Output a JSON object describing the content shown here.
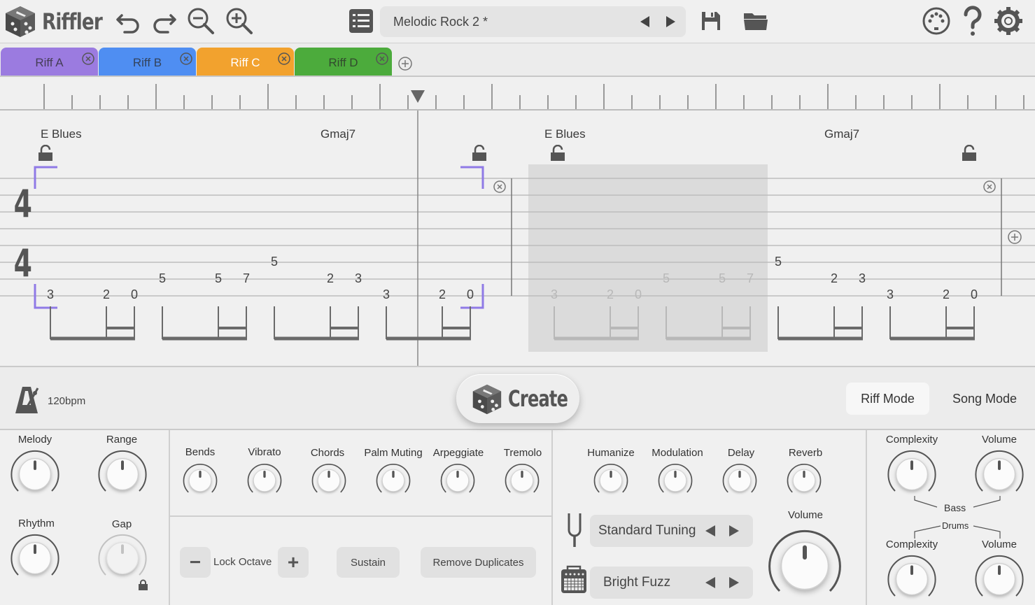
{
  "app": {
    "name": "Riffler"
  },
  "toolbar": {
    "preset_name": "Melodic Rock 2 *"
  },
  "tabs": [
    {
      "label": "Riff A",
      "color": "#9b7be0"
    },
    {
      "label": "Riff B",
      "color": "#4f8ef2"
    },
    {
      "label": "Riff C",
      "color": "#f2a22e"
    },
    {
      "label": "Riff D",
      "color": "#4cab3c"
    }
  ],
  "score": {
    "chords": [
      "E Blues",
      "Gmaj7",
      "E Blues",
      "Gmaj7"
    ],
    "time_signature": {
      "top": "4",
      "bottom": "4"
    },
    "notes": [
      "3",
      "2",
      "0",
      "5",
      "5",
      "7",
      "5",
      "2",
      "3",
      "3",
      "2",
      "0",
      "3",
      "2",
      "0",
      "5",
      "5",
      "7",
      "5",
      "2",
      "3",
      "3",
      "2",
      "0"
    ]
  },
  "transport": {
    "tempo": "120bpm",
    "create_label": "Create",
    "riff_mode": "Riff Mode",
    "song_mode": "Song Mode"
  },
  "melody_panel": {
    "melody": "Melody",
    "range": "Range",
    "rhythm": "Rhythm",
    "gap": "Gap"
  },
  "technique_panel": {
    "knobs": [
      "Bends",
      "Vibrato",
      "Chords",
      "Palm Muting",
      "Arpeggiate",
      "Tremolo"
    ],
    "lock_octave": "Lock Octave",
    "minus": "−",
    "plus": "+",
    "sustain": "Sustain",
    "remove_duplicates": "Remove Duplicates"
  },
  "fx_panel": {
    "knobs": [
      "Humanize",
      "Modulation",
      "Delay",
      "Reverb"
    ],
    "tuning": "Standard Tuning",
    "amp": "Bright Fuzz",
    "volume": "Volume"
  },
  "backing_panel": {
    "bass_label": "Bass",
    "drums_label": "Drums",
    "complexity": "Complexity",
    "volume": "Volume"
  },
  "colors": {
    "accent": "#8f7ae6",
    "ink": "#555555"
  }
}
